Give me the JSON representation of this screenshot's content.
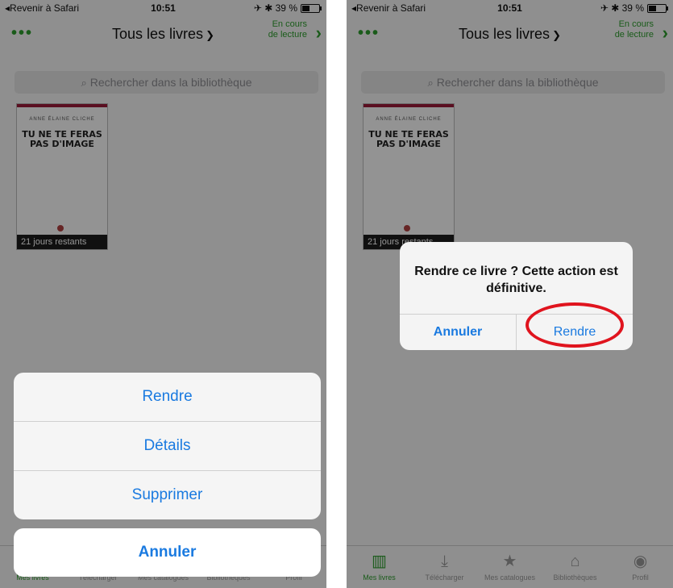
{
  "screens": [
    {
      "status": {
        "back": "◂Revenir à Safari",
        "time": "10:51",
        "right": "✈ ✱ 39 %"
      },
      "nav": {
        "dots": "•••",
        "title": "Tous les livres",
        "reading_line1": "En cours",
        "reading_line2": "de lecture"
      },
      "search_placeholder": "Rechercher dans la bibliothèque",
      "book": {
        "author": "ANNE ÉLAINE CLICHE",
        "title": "TU NE TE FERAS PAS D'IMAGE",
        "badge": "21 jours restants"
      },
      "tabs": [
        "Mes livres",
        "Télécharger",
        "Mes catalogues",
        "Bibliothèques",
        "Profil"
      ],
      "sheet": {
        "actions": [
          "Rendre",
          "Détails",
          "Supprimer"
        ],
        "cancel": "Annuler"
      }
    },
    {
      "status": {
        "back": "◂Revenir à Safari",
        "time": "10:51",
        "right": "✈ ✱ 39 %"
      },
      "nav": {
        "dots": "•••",
        "title": "Tous les livres",
        "reading_line1": "En cours",
        "reading_line2": "de lecture"
      },
      "search_placeholder": "Rechercher dans la bibliothèque",
      "book": {
        "author": "ANNE ÉLAINE CLICHE",
        "title": "TU NE TE FERAS PAS D'IMAGE",
        "badge": "21 jours restants"
      },
      "tabs": [
        "Mes livres",
        "Télécharger",
        "Mes catalogues",
        "Bibliothèques",
        "Profil"
      ],
      "alert": {
        "message": "Rendre ce livre ? Cette action est définitive.",
        "cancel": "Annuler",
        "confirm": "Rendre"
      }
    }
  ],
  "icons": [
    "chevron-down-icon",
    "chevron-right-icon",
    "search-icon",
    "books-icon",
    "download-icon",
    "star-icon",
    "library-icon",
    "profile-icon",
    "battery-icon"
  ],
  "colors": {
    "accent_green": "#2e9e2e",
    "ios_blue": "#1a7ae0",
    "highlight_red": "#e0141e",
    "book_band": "#9b1a3a"
  }
}
